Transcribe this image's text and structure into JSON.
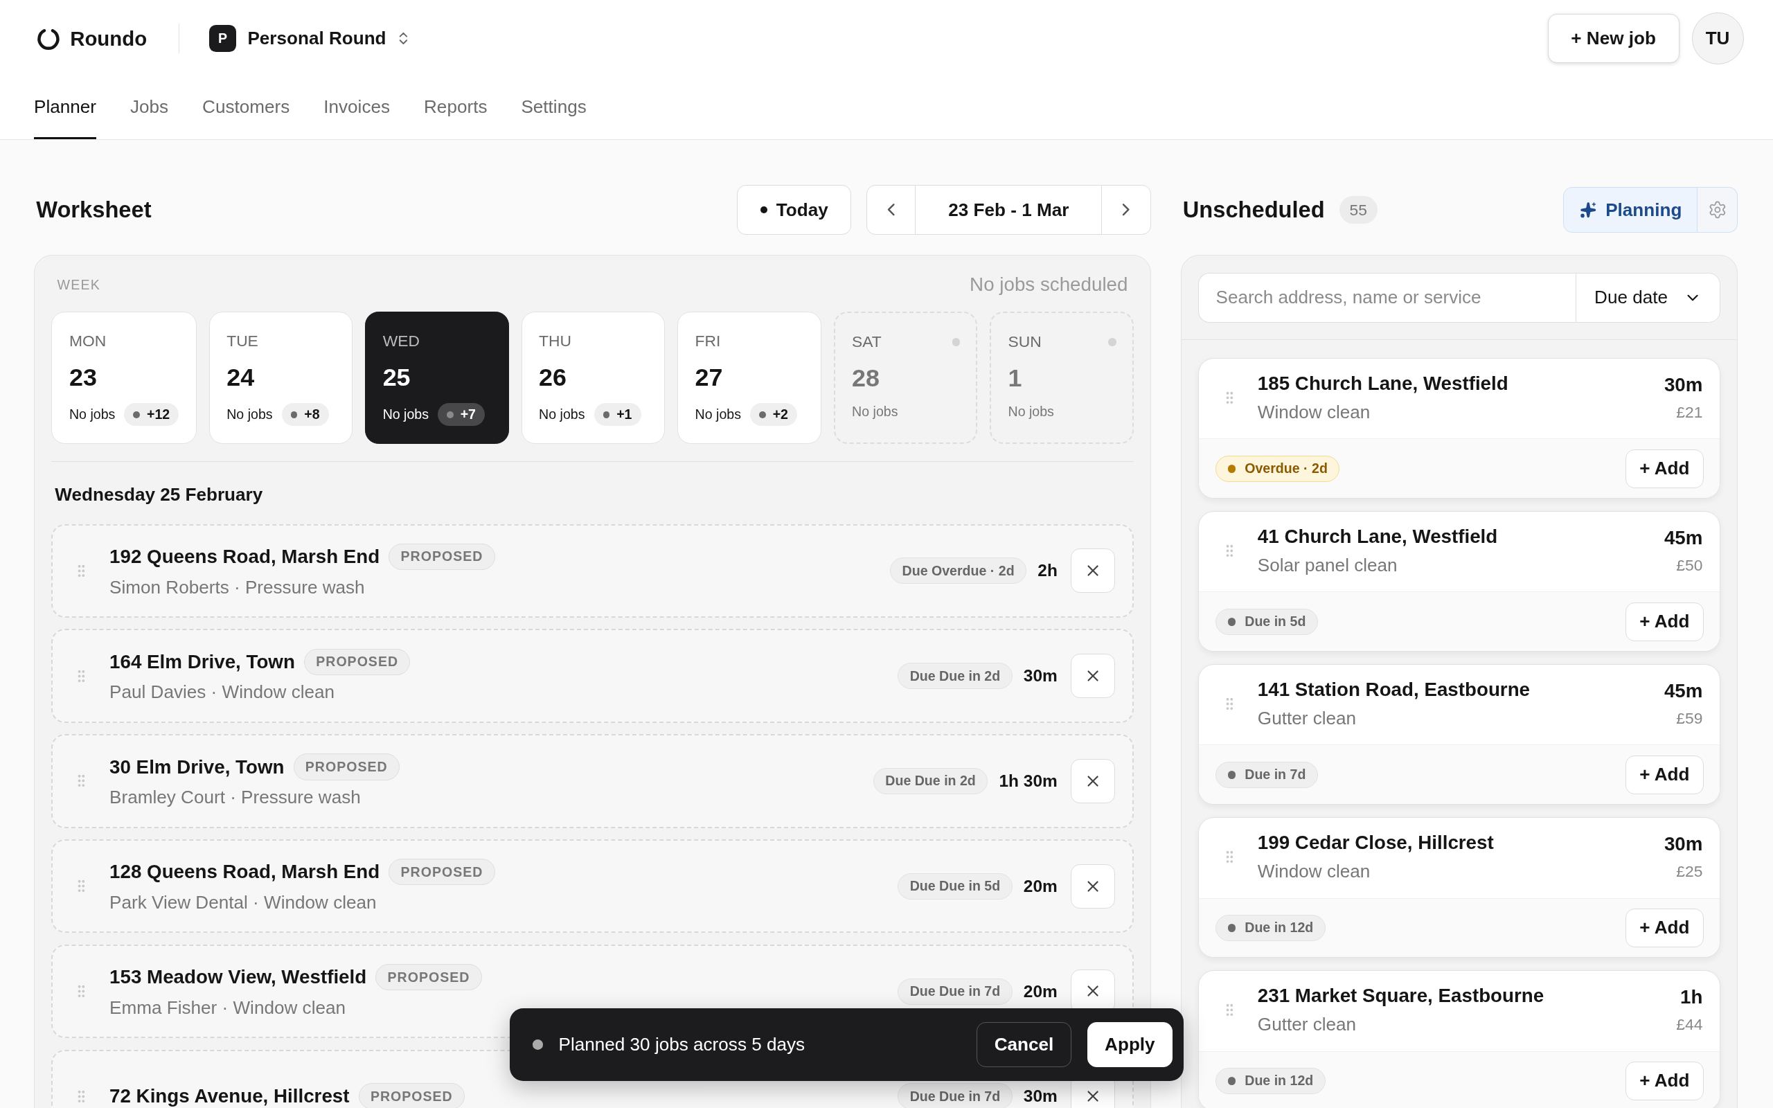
{
  "header": {
    "brand": "Roundo",
    "workspace": {
      "initial": "P",
      "name": "Personal Round"
    },
    "new_job_button": "+ New job",
    "avatar": "TU"
  },
  "nav": [
    {
      "label": "Planner",
      "selected": true
    },
    {
      "label": "Jobs",
      "selected": false
    },
    {
      "label": "Customers",
      "selected": false
    },
    {
      "label": "Invoices",
      "selected": false
    },
    {
      "label": "Reports",
      "selected": false
    },
    {
      "label": "Settings",
      "selected": false
    }
  ],
  "worksheet": {
    "title": "Worksheet",
    "today_button": "Today",
    "date_range": "23 Feb - 1 Mar",
    "week_label": "WEEK",
    "week_status": "No jobs scheduled",
    "days": [
      {
        "kind": "weekday",
        "day": "MON",
        "date": "23",
        "jobs": "No jobs",
        "extra": "+12",
        "selected": false
      },
      {
        "kind": "weekday",
        "day": "TUE",
        "date": "24",
        "jobs": "No jobs",
        "extra": "+8",
        "selected": false
      },
      {
        "kind": "weekday",
        "day": "WED",
        "date": "25",
        "jobs": "No jobs",
        "extra": "+7",
        "selected": true
      },
      {
        "kind": "weekday",
        "day": "THU",
        "date": "26",
        "jobs": "No jobs",
        "extra": "+1",
        "selected": false
      },
      {
        "kind": "weekday",
        "day": "FRI",
        "date": "27",
        "jobs": "No jobs",
        "extra": "+2",
        "selected": false
      },
      {
        "kind": "weekend",
        "day": "SAT",
        "date": "28",
        "jobs": "No jobs",
        "selected": false
      },
      {
        "kind": "weekend",
        "day": "SUN",
        "date": "1",
        "jobs": "No jobs",
        "selected": false
      }
    ],
    "section_title": "Wednesday 25 February",
    "jobs": [
      {
        "address": "192 Queens Road, Marsh End",
        "status": "PROPOSED",
        "subtitle": "Simon Roberts · Pressure wash",
        "due": "Due Overdue · 2d",
        "duration": "2h"
      },
      {
        "address": "164 Elm Drive, Town",
        "status": "PROPOSED",
        "subtitle": "Paul Davies · Window clean",
        "due": "Due Due in 2d",
        "duration": "30m"
      },
      {
        "address": "30 Elm Drive, Town",
        "status": "PROPOSED",
        "subtitle": "Bramley Court · Pressure wash",
        "due": "Due Due in 2d",
        "duration": "1h 30m"
      },
      {
        "address": "128 Queens Road, Marsh End",
        "status": "PROPOSED",
        "subtitle": "Park View Dental · Window clean",
        "due": "Due Due in 5d",
        "duration": "20m"
      },
      {
        "address": "153 Meadow View, Westfield",
        "status": "PROPOSED",
        "subtitle": "Emma Fisher · Window clean",
        "due": "Due Due in 7d",
        "duration": "20m"
      },
      {
        "address": "72 Kings Avenue, Hillcrest",
        "status": "PROPOSED",
        "due": "Due Due in 7d",
        "duration": "30m"
      }
    ]
  },
  "unscheduled": {
    "title": "Unscheduled",
    "count": "55",
    "planning_button": "Planning",
    "search": {
      "placeholder": "Search address, name or service"
    },
    "sort": "Due date",
    "jobs": [
      {
        "address": "185 Church Lane, Westfield",
        "service": "Window clean",
        "duration": "30m",
        "price": "£21",
        "due": "Overdue · 2d",
        "overdue": true,
        "add_button": "+ Add"
      },
      {
        "address": "41 Church Lane, Westfield",
        "service": "Solar panel clean",
        "duration": "45m",
        "price": "£50",
        "due": "Due in 5d",
        "overdue": false,
        "add_button": "+ Add"
      },
      {
        "address": "141 Station Road, Eastbourne",
        "service": "Gutter clean",
        "duration": "45m",
        "price": "£59",
        "due": "Due in 7d",
        "overdue": false,
        "add_button": "+ Add"
      },
      {
        "address": "199 Cedar Close, Hillcrest",
        "service": "Window clean",
        "duration": "30m",
        "price": "£25",
        "due": "Due in 12d",
        "overdue": false,
        "add_button": "+ Add"
      },
      {
        "address": "231 Market Square, Eastbourne",
        "service": "Gutter clean",
        "duration": "1h",
        "price": "£44",
        "due": "Due in 12d",
        "overdue": false,
        "add_button": "+ Add"
      }
    ]
  },
  "toast": {
    "message": "Planned 30 jobs across 5 days",
    "cancel": "Cancel",
    "apply": "Apply"
  }
}
